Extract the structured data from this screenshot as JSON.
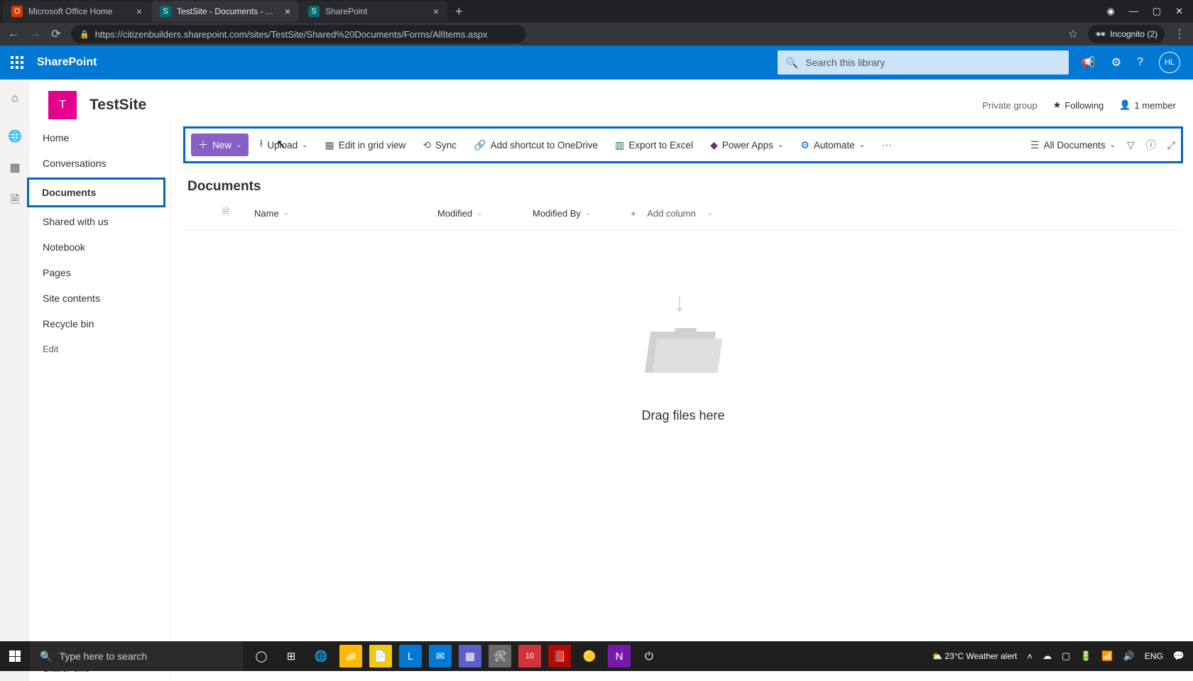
{
  "browser": {
    "tabs": [
      {
        "title": "Microsoft Office Home",
        "favicon_bg": "#d83b01",
        "favicon_txt": "O"
      },
      {
        "title": "TestSite - Documents - All Docum",
        "favicon_bg": "#036c70",
        "favicon_txt": "S"
      },
      {
        "title": "SharePoint",
        "favicon_bg": "#036c70",
        "favicon_txt": "S"
      }
    ],
    "active_tab": 1,
    "url": "https://citizenbuilders.sharepoint.com/sites/TestSite/Shared%20Documents/Forms/AllItems.aspx",
    "incognito_label": "Incognito (2)"
  },
  "suite": {
    "product": "SharePoint",
    "search_placeholder": "Search this library",
    "user_initials": "HL"
  },
  "site": {
    "logo_letter": "T",
    "name": "TestSite",
    "privacy": "Private group",
    "following_label": "Following",
    "members_label": "1 member"
  },
  "nav": {
    "items": [
      "Home",
      "Conversations",
      "Documents",
      "Shared with us",
      "Notebook",
      "Pages",
      "Site contents",
      "Recycle bin"
    ],
    "selected_index": 2,
    "edit_label": "Edit",
    "return_label": "Return to classic SharePoint"
  },
  "commandbar": {
    "new": "New",
    "upload": "Upload",
    "grid": "Edit in grid view",
    "sync": "Sync",
    "shortcut": "Add shortcut to OneDrive",
    "excel": "Export to Excel",
    "powerapps": "Power Apps",
    "automate": "Automate",
    "view": "All Documents"
  },
  "library": {
    "title": "Documents",
    "columns": {
      "name": "Name",
      "modified": "Modified",
      "modified_by": "Modified By",
      "add": "Add column"
    },
    "empty_text": "Drag files here"
  },
  "taskbar": {
    "search_placeholder": "Type here to search",
    "weather": "23°C  Weather alert",
    "lang": "ENG"
  }
}
